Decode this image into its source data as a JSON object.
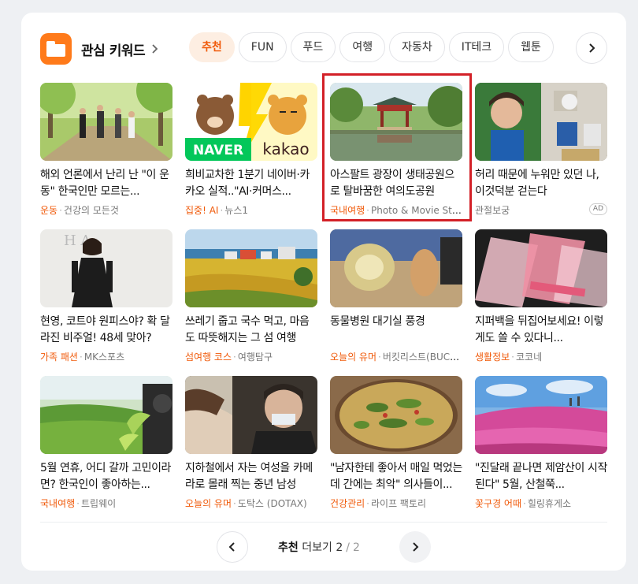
{
  "section": {
    "title": "관심 키워드",
    "chips": [
      "추천",
      "FUN",
      "푸드",
      "여행",
      "자동차",
      "IT테크",
      "웹툰"
    ]
  },
  "articles": [
    {
      "headline": "해외 언론에서 난리 난 \"이 운동\" 한국인만 모르는...",
      "category": "운동",
      "source": "건강의 모든것"
    },
    {
      "headline": "희비교차한 1분기 네이버·카카오 실적..\"AI·커머스...",
      "category": "집중! AI",
      "source": "뉴스1"
    },
    {
      "headline": "아스팔트 광장이 생태공원으로 탈바꿈한 여의도공원",
      "category": "국내여행",
      "source": "Photo & Movie Story"
    },
    {
      "headline": "허리 때문에 누워만 있던 나, 이것덕분 걷는다",
      "category": "",
      "source": "관절보궁",
      "ad": "AD"
    },
    {
      "headline": "현영, 코트야 원피스야? 확 달라진 비주얼! 48세 맞아?",
      "category": "가족 패션",
      "source": "MK스포츠"
    },
    {
      "headline": "쓰레기 줍고 국수 먹고, 마음도 따뜻해지는 그 섬 여행",
      "category": "섬여행 코스",
      "source": "여행탐구"
    },
    {
      "headline": "동물병원 대기실 풍경",
      "category": "오늘의 유머",
      "source": "버킷리스트(BUCKET...)"
    },
    {
      "headline": "지퍼백을 뒤집어보세요! 이렇게도 쓸 수 있다니...",
      "category": "생활정보",
      "source": "코코네"
    },
    {
      "headline": "5월 연휴, 어디 갈까 고민이라면? 한국인이 좋아하는...",
      "category": "국내여행",
      "source": "트립웨이"
    },
    {
      "headline": "지하철에서 자는 여성을 카메라로 몰래 찍는 중년 남성",
      "category": "오늘의 유머",
      "source": "도탁스 (DOTAX)"
    },
    {
      "headline": "\"남자한테 좋아서 매일 먹었는데 간에는 최악\" 의사들이...",
      "category": "건강관리",
      "source": "라이프 팩토리"
    },
    {
      "headline": "\"진달래 끝나면 제암산이 시작된다\" 5월, 산철쭉...",
      "category": "꽃구경 어때",
      "source": "힐링휴게소"
    }
  ],
  "pager": {
    "label": "추천",
    "more": "더보기",
    "current": "2",
    "total": "2"
  },
  "colors": {
    "accent": "#f05a0a",
    "highlight": "#d32027",
    "folder": "#ff7a1a"
  }
}
